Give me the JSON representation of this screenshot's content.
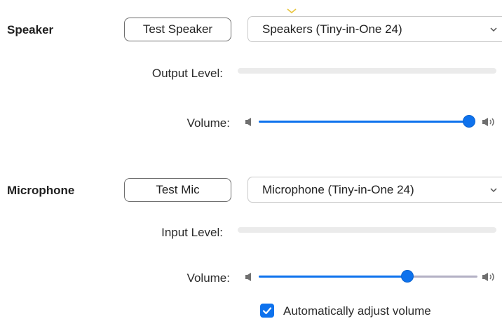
{
  "speaker": {
    "title": "Speaker",
    "test_button": "Test Speaker",
    "device": "Speakers (Tiny-in-One 24)",
    "output_level_label": "Output Level:",
    "output_level": 0,
    "volume_label": "Volume:",
    "volume": 1.0
  },
  "microphone": {
    "title": "Microphone",
    "test_button": "Test Mic",
    "device": "Microphone (Tiny-in-One 24)",
    "input_level_label": "Input Level:",
    "input_level": 0,
    "volume_label": "Volume:",
    "volume": 0.68,
    "auto_adjust_label": "Automatically adjust volume",
    "auto_adjust_checked": true
  },
  "icons": {
    "dropdown": "chevron-down-icon",
    "volume_low": "speaker-low-icon",
    "volume_high": "speaker-high-icon",
    "check": "checkmark-icon"
  },
  "colors": {
    "accent": "#0e72ed",
    "track_inactive": "#b3b0c4",
    "level_bar": "#ebebeb",
    "chevron_marker": "#e8c43a"
  }
}
